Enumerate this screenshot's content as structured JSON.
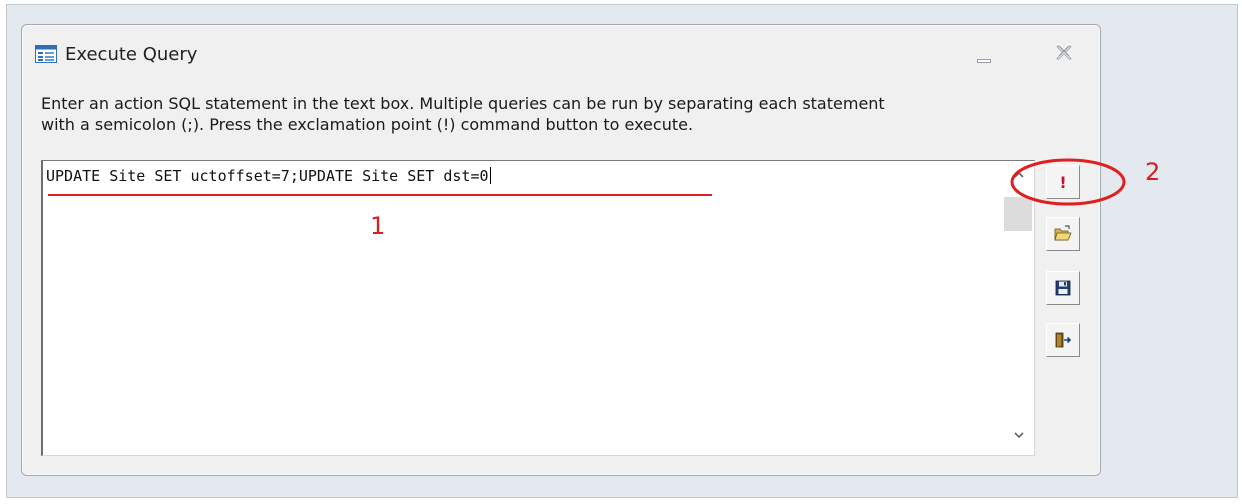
{
  "window": {
    "title": "Execute Query",
    "instructions": [
      "Enter an action SQL statement in the text box.  Multiple queries can be run by separating each statement",
      "with a semicolon (;).  Press the exclamation point (!) command button to execute."
    ]
  },
  "query_editor": {
    "value": "UPDATE Site SET uctoffset=7;UPDATE Site SET dst=0"
  },
  "toolbar": {
    "execute_glyph": "!",
    "buttons": [
      {
        "icon": "exclamation-icon",
        "action": "execute"
      },
      {
        "icon": "open-folder-icon",
        "action": "open"
      },
      {
        "icon": "save-disk-icon",
        "action": "save"
      },
      {
        "icon": "exit-door-icon",
        "action": "close"
      }
    ]
  },
  "annotations": {
    "label_1": "1",
    "label_2": "2",
    "color": "#e02020"
  },
  "colors": {
    "window_bg": "#f0f0f0",
    "accent_red": "#c8102e",
    "app_icon_blue": "#2e6fb7"
  }
}
